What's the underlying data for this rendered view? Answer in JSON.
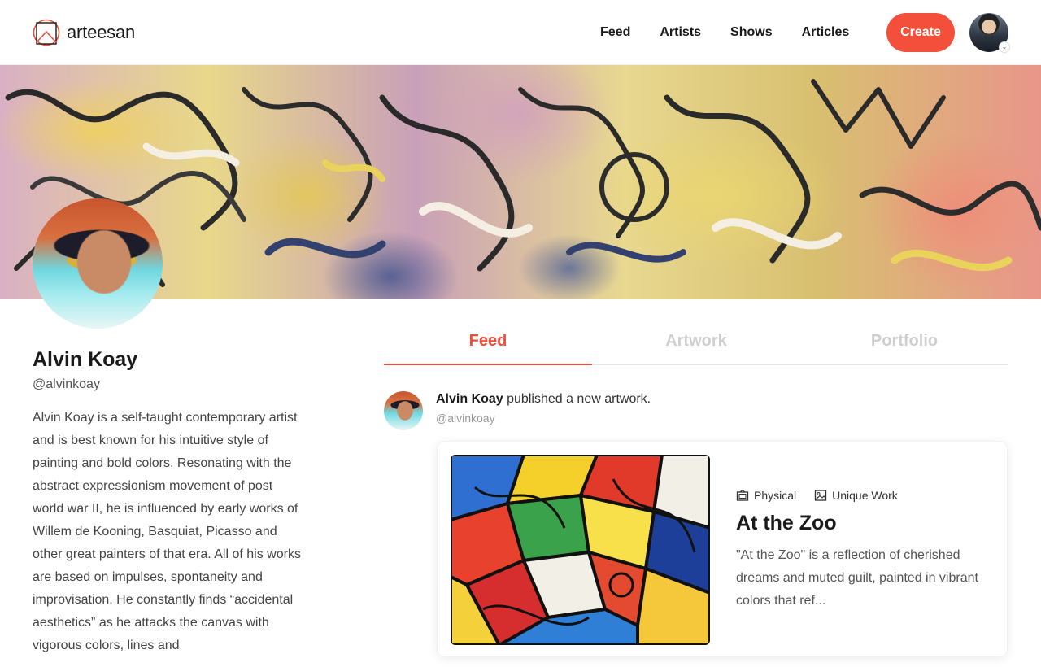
{
  "brand": {
    "name": "arteesan"
  },
  "nav": {
    "items": [
      "Feed",
      "Artists",
      "Shows",
      "Articles"
    ],
    "create_label": "Create"
  },
  "profile": {
    "name": "Alvin Koay",
    "handle": "@alvinkoay",
    "bio": "Alvin Koay is a self-taught contemporary artist and is best known for his intuitive style of painting and bold colors. Resonating with the abstract expressionism movement of post world war II, he is influenced by early works of Willem de Kooning, Basquiat, Picasso and other great painters of that era. All of his works are based on impulses, spontaneity and improvisation. He constantly finds “accidental aesthetics” as he attacks the canvas with vigorous colors, lines and"
  },
  "tabs": [
    {
      "label": "Feed",
      "active": true
    },
    {
      "label": "Artwork",
      "active": false
    },
    {
      "label": "Portfolio",
      "active": false
    }
  ],
  "post": {
    "author": "Alvin Koay",
    "action": " published a new artwork.",
    "handle": "@alvinkoay",
    "artwork": {
      "type_label": "Physical",
      "edition_label": "Unique Work",
      "title": "At the Zoo",
      "description": "\"At the Zoo\" is a reflection of cherished dreams and muted guilt, painted in vibrant colors that ref..."
    }
  },
  "colors": {
    "accent": "#f34f3a",
    "tab_active": "#f04e3a",
    "tab_inactive": "#cfcfcf"
  },
  "icons": {
    "physical": "frame-icon",
    "unique": "image-icon",
    "avatar_caret": "chevron-down-icon"
  }
}
